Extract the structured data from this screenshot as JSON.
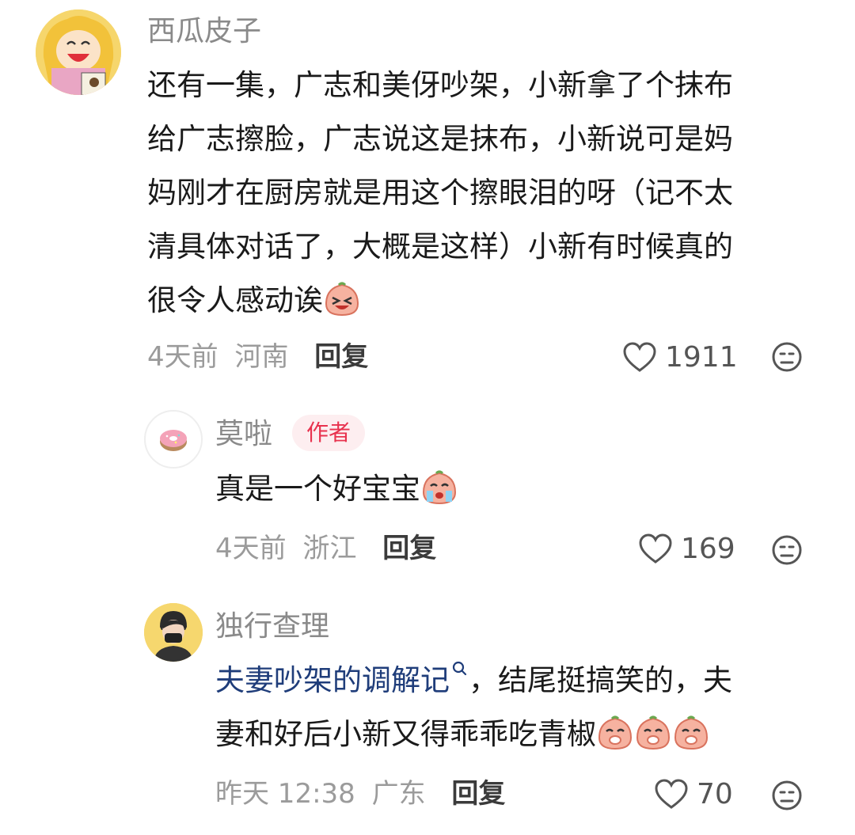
{
  "comments": [
    {
      "username": "西瓜皮子",
      "lines": [
        "还有一集，广志和美伢吵架，小新拿了个抹布",
        "给广志擦脸，广志说这是抹布，小新说可是妈",
        "妈刚才在厨房就是用这个擦眼泪的呀（记不太",
        "清具体对话了，大概是这样）小新有时候真的",
        "很令人感动诶"
      ],
      "time": "4天前",
      "location": "河南",
      "reply_label": "回复",
      "likes": "1911"
    },
    {
      "username": "莫啦",
      "badge": "作者",
      "text": "真是一个好宝宝",
      "time": "4天前",
      "location": "浙江",
      "reply_label": "回复",
      "likes": "169"
    },
    {
      "username": "独行查理",
      "link_text": "夫妻吵架的调解记",
      "line1_rest": "，结尾挺搞笑的，夫",
      "line2": "妻和好后小新又得乖乖吃青椒",
      "time": "昨天 12:38",
      "location": "广东",
      "reply_label": "回复",
      "likes": "70"
    }
  ],
  "colors": {
    "author_badge_bg": "#fdeef0",
    "author_badge_text": "#e8324e",
    "link": "#1f3d7a"
  }
}
